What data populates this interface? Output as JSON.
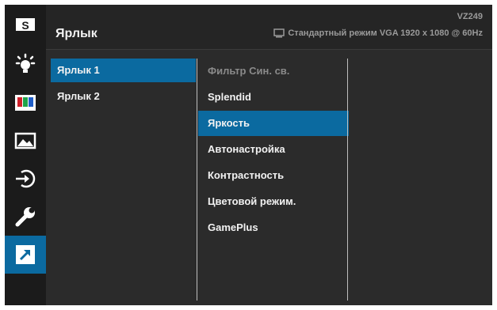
{
  "header": {
    "title": "Ярлык",
    "model": "VZ249",
    "mode_text": "Стандартный режим VGA  1920 x 1080 @ 60Hz"
  },
  "sidebar": {
    "items": [
      {
        "icon": "splendid-s-icon",
        "label": "S"
      },
      {
        "icon": "bluelight-filter-icon"
      },
      {
        "icon": "color-icon"
      },
      {
        "icon": "image-icon"
      },
      {
        "icon": "input-select-icon"
      },
      {
        "icon": "system-setup-wrench-icon"
      },
      {
        "icon": "shortcut-arrow-icon",
        "active": true
      }
    ]
  },
  "shortcut_list": {
    "items": [
      {
        "label": "Ярлык 1",
        "selected": true
      },
      {
        "label": "Ярлык 2",
        "selected": false
      }
    ]
  },
  "function_list": {
    "items": [
      {
        "label": "Фильтр Син. св.",
        "dimmed": true
      },
      {
        "label": "Splendid"
      },
      {
        "label": "Яркость",
        "selected": true
      },
      {
        "label": "Автонастройка"
      },
      {
        "label": "Контрастность"
      },
      {
        "label": "Цветовой режим."
      },
      {
        "label": "GamePlus"
      }
    ]
  },
  "colors": {
    "accent": "#0b6aa0",
    "panel": "#2b2b2b",
    "sidebar": "#1b1b1b"
  }
}
